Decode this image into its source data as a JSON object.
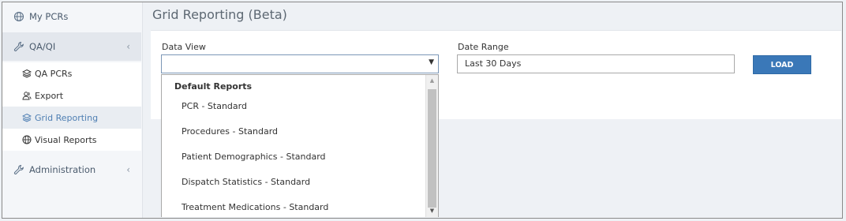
{
  "sidebar": {
    "my_pcrs": "My PCRs",
    "qa_qi": "QA/QI",
    "qa_chevron": "‹",
    "qa_pcrs": "QA PCRs",
    "export": "Export",
    "grid_reporting": "Grid Reporting",
    "visual_reports": "Visual Reports",
    "administration": "Administration",
    "admin_chevron": "‹"
  },
  "main": {
    "title": "Grid Reporting (Beta)",
    "data_view_label": "Data View",
    "data_view_value": "",
    "date_range_label": "Date Range",
    "date_range_value": "Last 30 Days",
    "load_button": "LOAD"
  },
  "dropdown": {
    "group_label": "Default Reports",
    "options": [
      "PCR - Standard",
      "Procedures - Standard",
      "Patient Demographics - Standard",
      "Dispatch Statistics - Standard",
      "Treatment Medications - Standard"
    ]
  },
  "icons": {
    "my_pcrs": "globe-icon",
    "qa_qi": "wrench-icon",
    "qa_pcrs": "layers-icon",
    "export": "users-icon",
    "grid_reporting": "layers-icon",
    "visual_reports": "globe-icon",
    "administration": "wrench-icon"
  },
  "colors": {
    "accent": "#3a78b8",
    "active_nav_text": "#4f7fb3"
  }
}
